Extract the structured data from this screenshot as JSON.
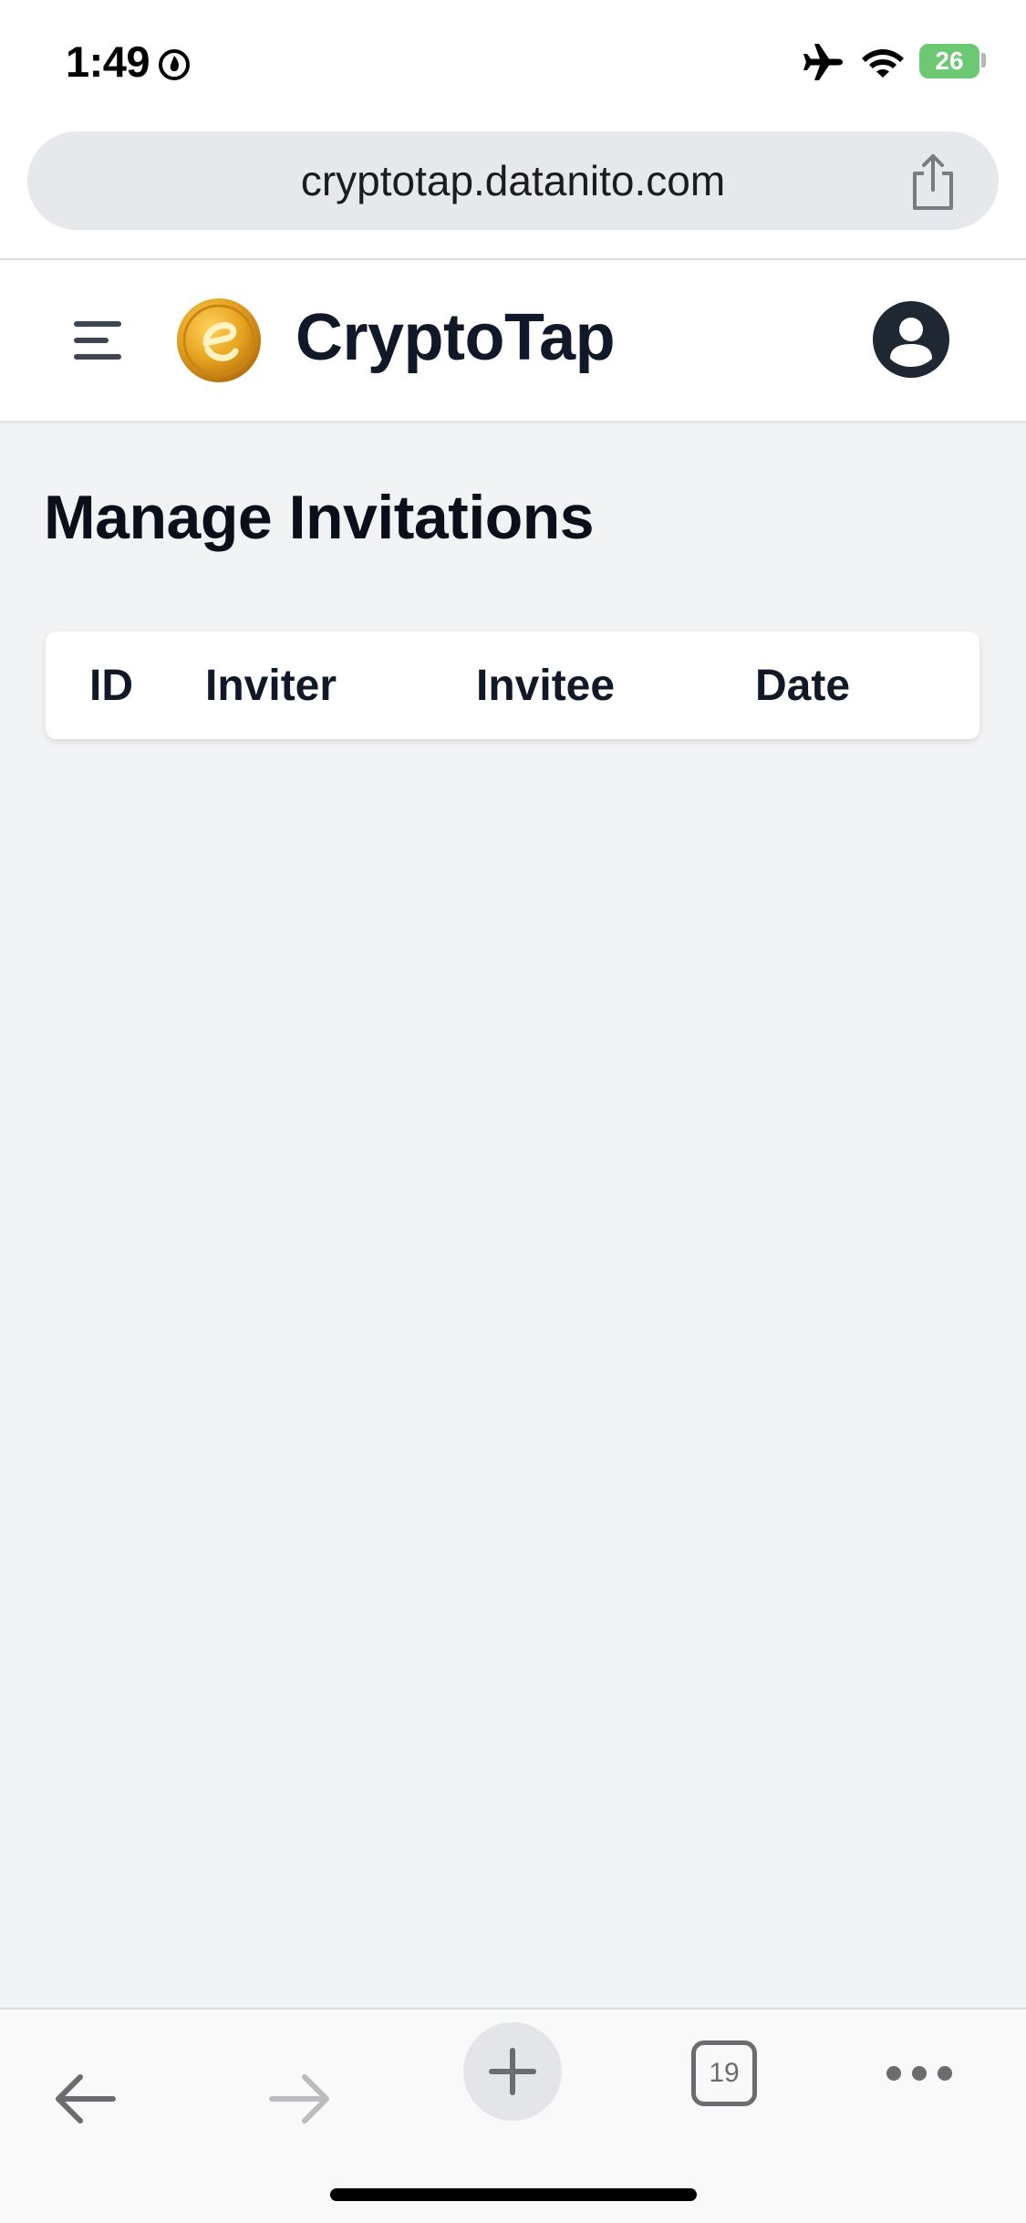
{
  "status_bar": {
    "time": "1:49",
    "battery_level": "26",
    "icons": [
      "focus-icon",
      "airplane-icon",
      "wifi-icon",
      "battery-icon"
    ],
    "battery_color": "#6cc872"
  },
  "browser": {
    "url": "cryptotap.datanito.com",
    "share_icon": "share-icon"
  },
  "header": {
    "brand": "CryptoTap",
    "menu_icon": "hamburger-menu-icon",
    "logo_icon": "cryptotap-coin-logo",
    "account_icon": "user-avatar-icon"
  },
  "main": {
    "title": "Manage Invitations",
    "table": {
      "columns": [
        "ID",
        "Inviter",
        "Invitee",
        "Date"
      ],
      "rows": []
    }
  },
  "toolbar": {
    "tab_count": "19",
    "icons": [
      "back-arrow-icon",
      "forward-arrow-icon",
      "plus-icon",
      "tabs-icon",
      "more-icon"
    ]
  },
  "colors": {
    "page_background": "#f2f3f5",
    "header_background": "#ffffff",
    "logo_gold": "#e6a21f"
  }
}
